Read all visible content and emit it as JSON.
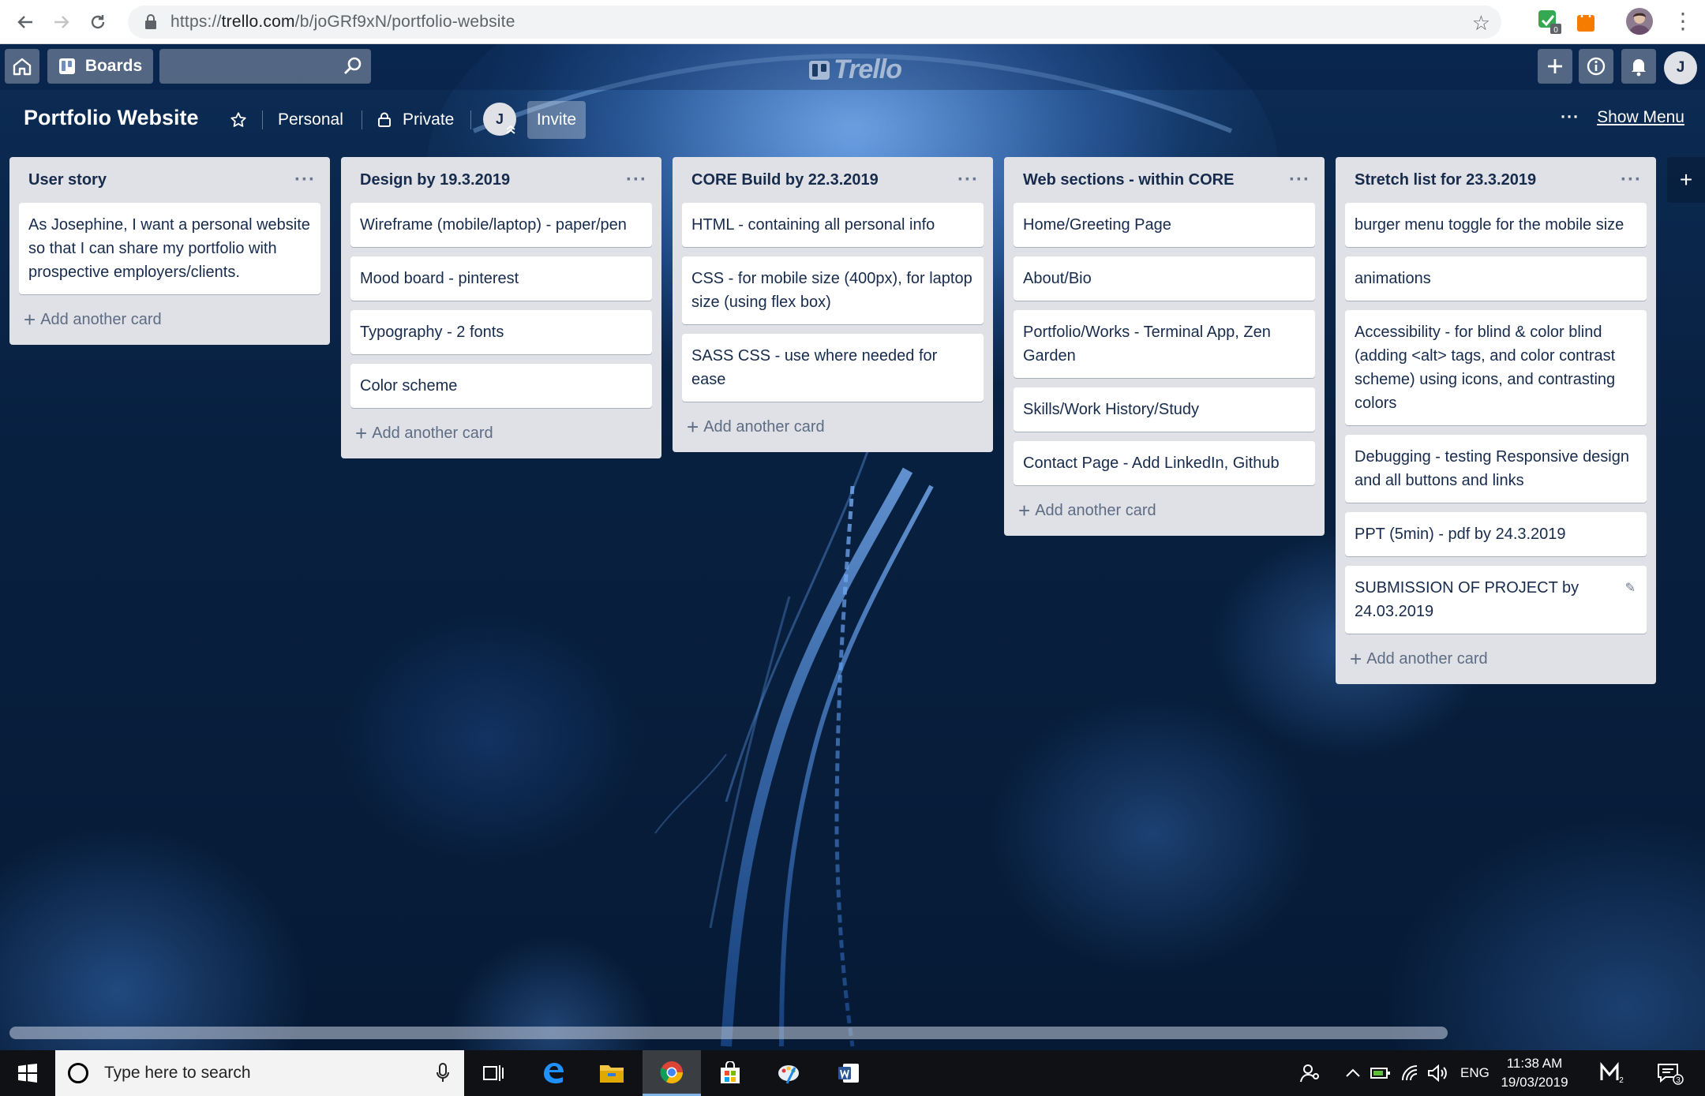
{
  "browser": {
    "url_prefix": "https://",
    "url_host": "trello.com",
    "url_path": "/b/joGRf9xN/portfolio-website",
    "ext_badge": "0"
  },
  "header": {
    "boards_label": "Boards",
    "logo_text": "Trello",
    "avatar_initial": "J"
  },
  "board": {
    "title": "Portfolio Website",
    "team_label": "Personal",
    "visibility_label": "Private",
    "member_initial": "J",
    "invite_label": "Invite",
    "show_menu_dots": "···",
    "show_menu_label": "Show Menu",
    "add_list_symbol": "+"
  },
  "lists": [
    {
      "title": "User story",
      "cards": [
        "As Josephine, I want a personal website so that I can share my portfolio with prospective employers/clients."
      ],
      "add_label": "Add another card"
    },
    {
      "title": "Design by 19.3.2019",
      "cards": [
        "Wireframe (mobile/laptop) - paper/pen",
        "Mood board - pinterest",
        "Typography - 2 fonts",
        "Color scheme"
      ],
      "add_label": "Add another card"
    },
    {
      "title": "CORE Build by 22.3.2019",
      "cards": [
        "HTML - containing all personal info",
        "CSS - for mobile size (400px), for laptop size (using flex box)",
        "SASS CSS - use where needed for ease"
      ],
      "add_label": "Add another card"
    },
    {
      "title": "Web sections - within CORE",
      "cards": [
        "Home/Greeting Page",
        "About/Bio",
        "Portfolio/Works - Terminal App, Zen Garden",
        "Skills/Work History/Study",
        "Contact Page - Add LinkedIn, Github"
      ],
      "add_label": "Add another card"
    },
    {
      "title": "Stretch list for 23.3.2019",
      "cards": [
        "burger menu toggle for the mobile size",
        "animations",
        "Accessibility - for blind & color blind (adding <alt> tags, and color contrast scheme) using icons, and contrasting colors",
        "Debugging - testing Responsive design and all buttons and links",
        "PPT (5min) - pdf by 24.3.2019",
        "SUBMISSION OF PROJECT by 24.03.2019"
      ],
      "add_label": "Add another card"
    }
  ],
  "taskbar": {
    "search_placeholder": "Type here to search",
    "language": "ENG",
    "time": "11:38 AM",
    "date": "19/03/2019",
    "mail_badge": "2",
    "notification_count": "3"
  },
  "colors": {
    "list_bg": "#dfe1e6",
    "card_text": "#172b4d",
    "muted_text": "#5e6c84"
  }
}
